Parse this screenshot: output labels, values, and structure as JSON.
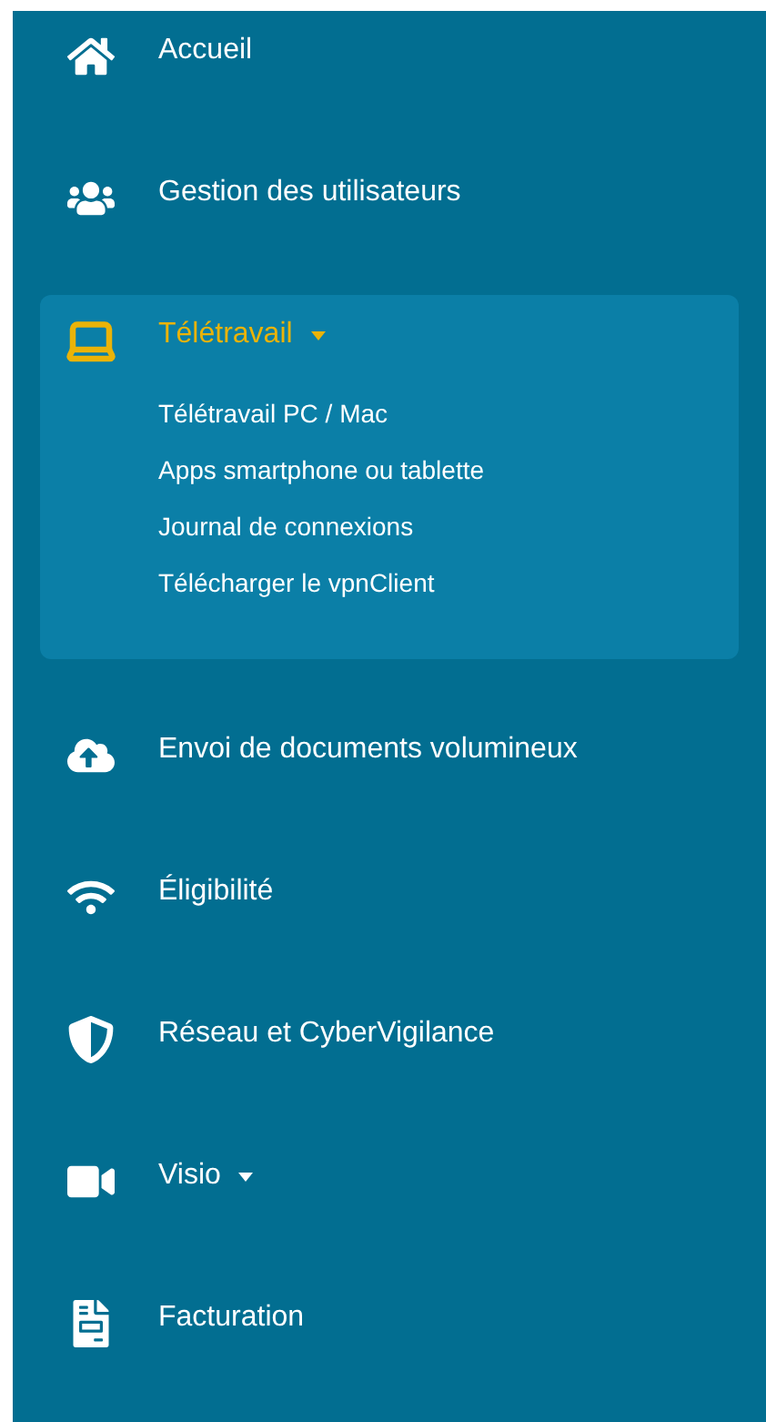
{
  "sidebar": {
    "items": [
      {
        "kind": "link",
        "label": "Accueil",
        "selected": false
      },
      {
        "kind": "link",
        "label": "Gestion des utilisateurs",
        "selected": false
      },
      {
        "kind": "dropdown",
        "label": "Télétravail",
        "selected": true,
        "expanded": true,
        "children": [
          {
            "label": "Télétravail PC / Mac"
          },
          {
            "label": "Apps smartphone ou tablette"
          },
          {
            "label": "Journal de connexions"
          },
          {
            "label": "Télécharger le vpnClient"
          }
        ]
      },
      {
        "kind": "link",
        "label": "Envoi de documents volumineux",
        "selected": false
      },
      {
        "kind": "link",
        "label": "Éligibilité",
        "selected": false
      },
      {
        "kind": "link",
        "label": "Réseau et CyberVigilance",
        "selected": false
      },
      {
        "kind": "dropdown",
        "label": "Visio",
        "selected": false,
        "expanded": false
      },
      {
        "kind": "link",
        "label": "Facturation",
        "selected": false
      }
    ]
  }
}
